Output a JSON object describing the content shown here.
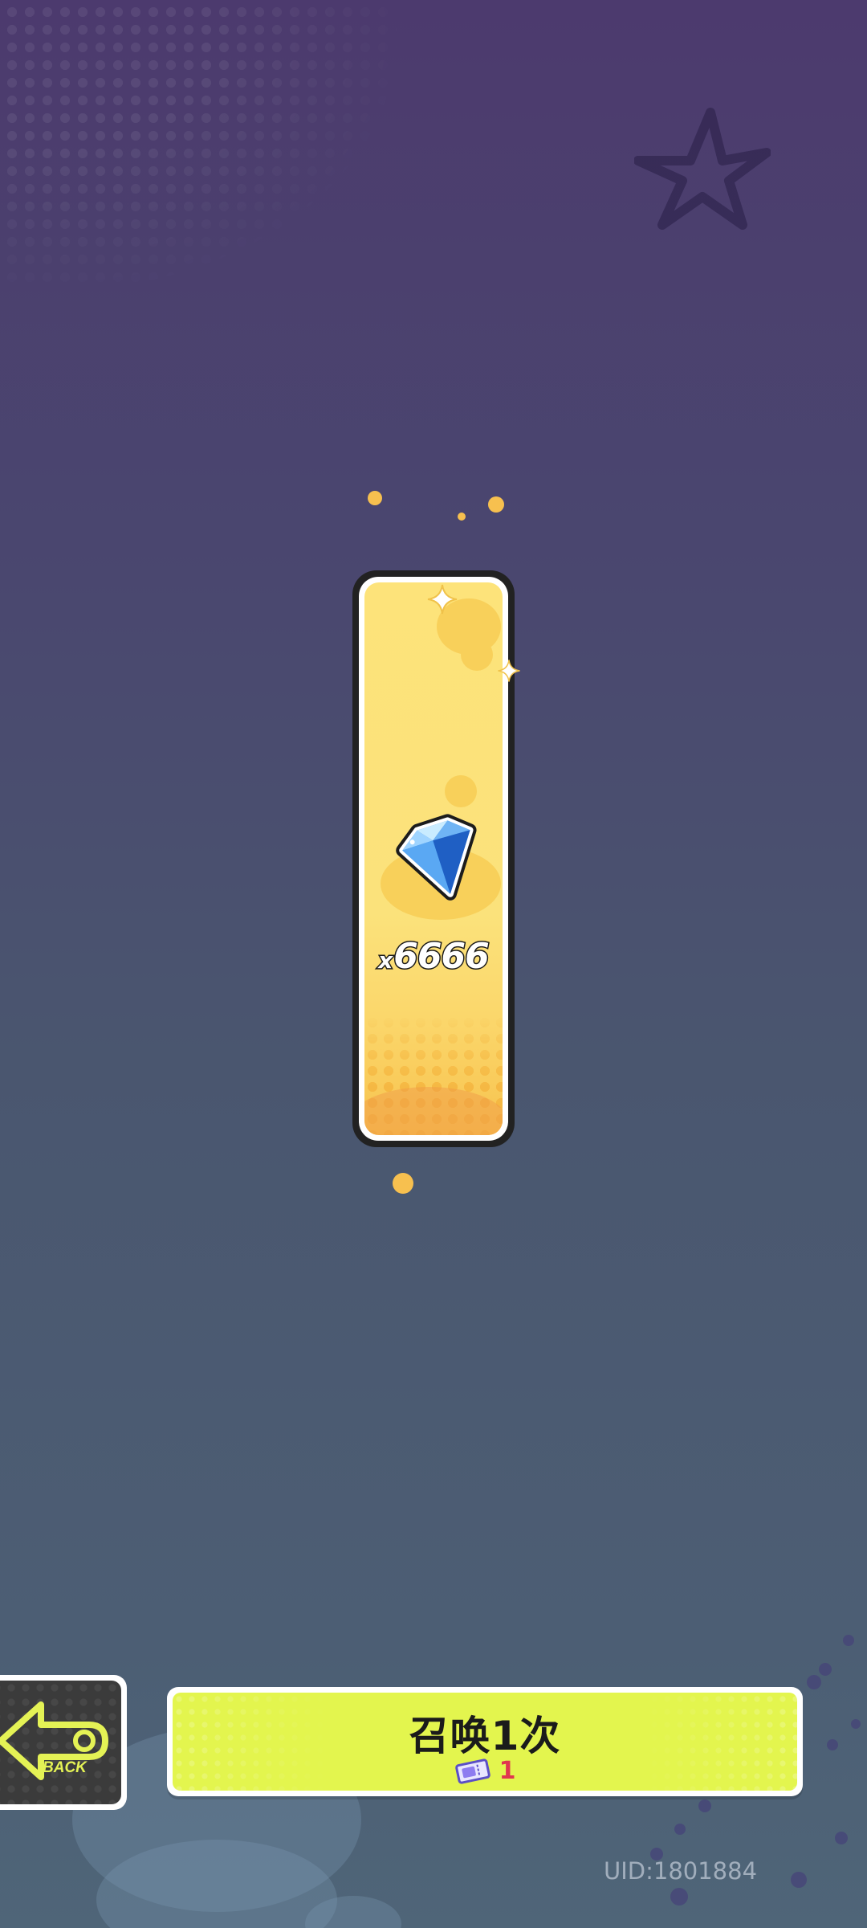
{
  "reward": {
    "item_icon": "blue-diamond-gem-icon",
    "amount_prefix": "x",
    "amount": "6666"
  },
  "actions": {
    "back": {
      "icon": "back-arrow-icon",
      "label": "BACK"
    },
    "summon": {
      "label": "召唤1次",
      "cost_icon": "summon-ticket-icon",
      "cost_value": "1"
    }
  },
  "footer": {
    "uid": "UID:1801884"
  },
  "colors": {
    "summon_button": "#e3f54e",
    "card_face": "#fde37a",
    "cost_value": "#e0364f",
    "confetti": "#f7c04f"
  }
}
